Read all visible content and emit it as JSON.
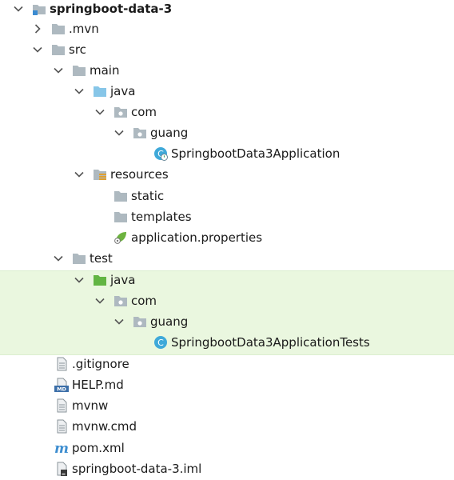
{
  "tree": {
    "root": {
      "label": "springboot-data-3"
    },
    "mvn": {
      "label": ".mvn"
    },
    "src": {
      "label": "src"
    },
    "main": {
      "label": "main"
    },
    "main_java": {
      "label": "java"
    },
    "main_com": {
      "label": "com"
    },
    "main_guang": {
      "label": "guang"
    },
    "app_class": {
      "label": "SpringbootData3Application"
    },
    "resources": {
      "label": "resources"
    },
    "static": {
      "label": "static"
    },
    "templates": {
      "label": "templates"
    },
    "app_props": {
      "label": "application.properties"
    },
    "test": {
      "label": "test"
    },
    "test_java": {
      "label": "java"
    },
    "test_com": {
      "label": "com"
    },
    "test_guang": {
      "label": "guang"
    },
    "test_class": {
      "label": "SpringbootData3ApplicationTests"
    },
    "gitignore": {
      "label": ".gitignore"
    },
    "help": {
      "label": "HELP.md"
    },
    "mvnw": {
      "label": "mvnw"
    },
    "mvnw_cmd": {
      "label": "mvnw.cmd"
    },
    "pom": {
      "label": "pom.xml"
    },
    "iml": {
      "label": "springboot-data-3.iml"
    }
  },
  "icons": {
    "folder": "folder-icon",
    "module_folder": "module-folder-icon",
    "source_root": "source-root-folder-icon",
    "test_root": "test-root-folder-icon",
    "package": "package-icon",
    "resources": "resources-folder-icon",
    "spring_class": "spring-boot-class-icon",
    "test_class": "java-class-icon",
    "spring_props": "spring-leaf-icon",
    "text_file": "text-file-icon",
    "markdown": "markdown-file-icon",
    "maven": "maven-icon",
    "iml": "iml-file-icon"
  },
  "colors": {
    "folder": "#aeb9c0",
    "source_root": "#87c6e8",
    "test_root": "#62b543",
    "test_highlight": "#eaf7df",
    "class_icon": "#3fa9d9",
    "spring": "#6db33f",
    "maven": "#3e8ed0"
  }
}
